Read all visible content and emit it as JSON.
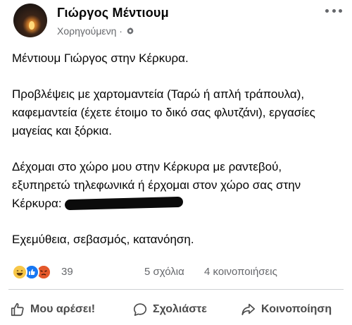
{
  "post": {
    "author": "Γιώργος Μέντιουμ",
    "sponsored_label": "Χορηγούμενη ·",
    "paragraphs": [
      "Μέντιουμ Γιώργος στην Κέρκυρα.",
      "Προβλέψεις με χαρτομαντεία (Ταρώ ή απλή τράπουλα), καφεμαντεία (έχετε έτοιμο το δικό σας φλυτζάνι), εργασίες μαγείας και ξόρκια.",
      "Δέχομαι στο χώρο μου στην Κέρκυρα με ραντεβού, εξυπηρετώ τηλεφωνικά ή έρχομαι στον χώρο σας στην Κέρκυρα:",
      "Εχεμύθεια, σεβασμός, κατανόηση."
    ]
  },
  "stats": {
    "reaction_icons": [
      "haha-icon",
      "like-icon",
      "angry-icon"
    ],
    "reaction_count": "39",
    "comments": "5 σχόλια",
    "shares": "4 κοινοποιήσεις"
  },
  "actions": {
    "like": "Μου αρέσει!",
    "comment": "Σχολιάστε",
    "share": "Κοινοποίηση"
  },
  "colors": {
    "text": "#050505",
    "secondary": "#65676b",
    "like_blue": "#1877f2",
    "haha_yellow": "#f7c748",
    "angry_orange": "#e3582b"
  }
}
